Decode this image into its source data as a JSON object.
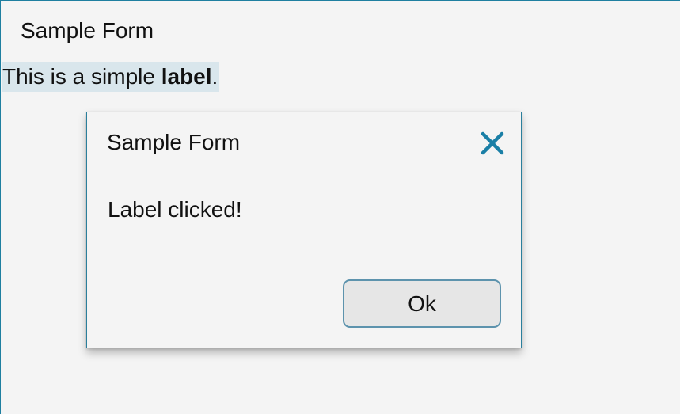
{
  "window": {
    "title": "Sample Form"
  },
  "label": {
    "text_prefix": "This is a simple ",
    "text_bold": "label",
    "text_suffix": "."
  },
  "dialog": {
    "title": "Sample Form",
    "message": "Label clicked!",
    "ok_label": "Ok",
    "close_icon": "close-icon"
  },
  "colors": {
    "accent": "#1f7fa0",
    "label_highlight": "#d9e6ec",
    "background": "#f4f4f4"
  }
}
